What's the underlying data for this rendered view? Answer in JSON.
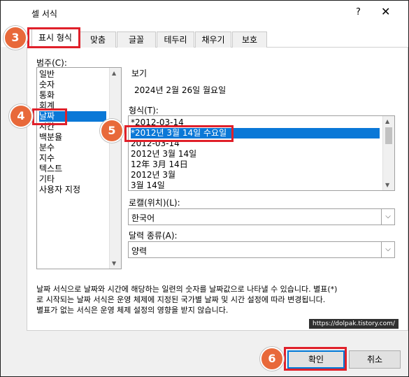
{
  "dialog": {
    "title": "셀 서식",
    "help_label": "?",
    "close_label": "✕"
  },
  "tabs": [
    {
      "label": "표시 형식",
      "active": true
    },
    {
      "label": "맞춤"
    },
    {
      "label": "글꼴"
    },
    {
      "label": "테두리"
    },
    {
      "label": "채우기"
    },
    {
      "label": "보호"
    }
  ],
  "category": {
    "label": "범주(C):",
    "items": [
      "일반",
      "숫자",
      "통화",
      "회계",
      "날짜",
      "시간",
      "백분율",
      "분수",
      "지수",
      "텍스트",
      "기타",
      "사용자 지정"
    ],
    "selected": "날짜"
  },
  "sample": {
    "label": "보기",
    "value": "2024년 2월 26일 월요일"
  },
  "format": {
    "label": "형식(T):",
    "items": [
      "*2012-03-14",
      "*2012년 3월 14일 수요일",
      "2012-03-14",
      "2012년 3월 14일",
      "12年 3月 14日",
      "2012년 3월",
      "3월 14일"
    ],
    "selected": "*2012년 3월 14일 수요일"
  },
  "locale": {
    "label": "로캘(위치)(L):",
    "value": "한국어"
  },
  "calendar": {
    "label": "달력 종류(A):",
    "value": "양력"
  },
  "description": {
    "line1": "날짜 서식으로 날짜와 시간에 해당하는 일련의 숫자를 날짜값으로 나타낼 수 있습니다. 별표(*)",
    "line2": "로 시작되는 날짜 서식은 운영 체제에 지정된 국가별 날짜 및 시간 설정에 따라 변경됩니다.",
    "line3": "별표가 없는 서식은 운영 체제 설정의 영향을 받지 않습니다."
  },
  "watermark": "https://dolpak.tistory.com/",
  "buttons": {
    "ok": "확인",
    "cancel": "취소"
  },
  "callouts": [
    "3",
    "4",
    "5",
    "6"
  ],
  "colors": {
    "callout": "#e8693a",
    "highlight": "#e0202a",
    "selection": "#0a78d7"
  }
}
